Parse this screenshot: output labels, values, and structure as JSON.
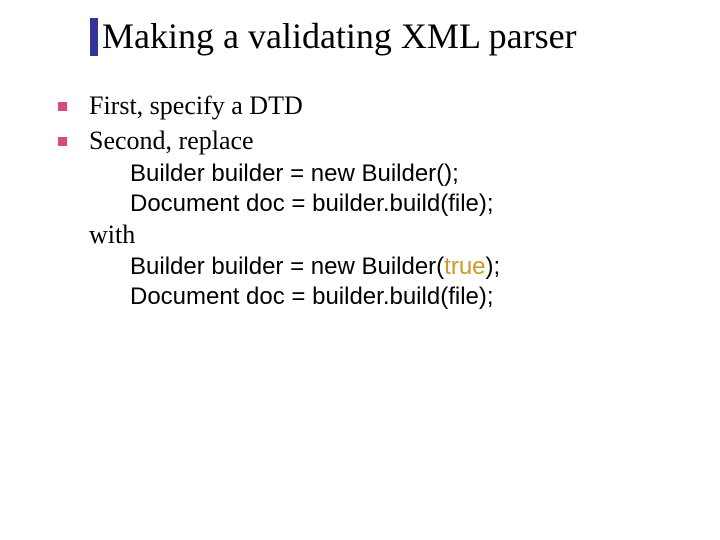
{
  "title": "Making a validating XML parser",
  "bullets": [
    {
      "text": "First, specify a DTD"
    },
    {
      "text": "Second, replace"
    }
  ],
  "code_before": [
    "Builder builder = new Builder();",
    "Document doc = builder.build(file);"
  ],
  "with_label": "with",
  "code_after_pre": "Builder builder = new Builder(",
  "code_after_true": "true",
  "code_after_post": ");",
  "code_after_line2": "Document doc = builder.build(file);"
}
